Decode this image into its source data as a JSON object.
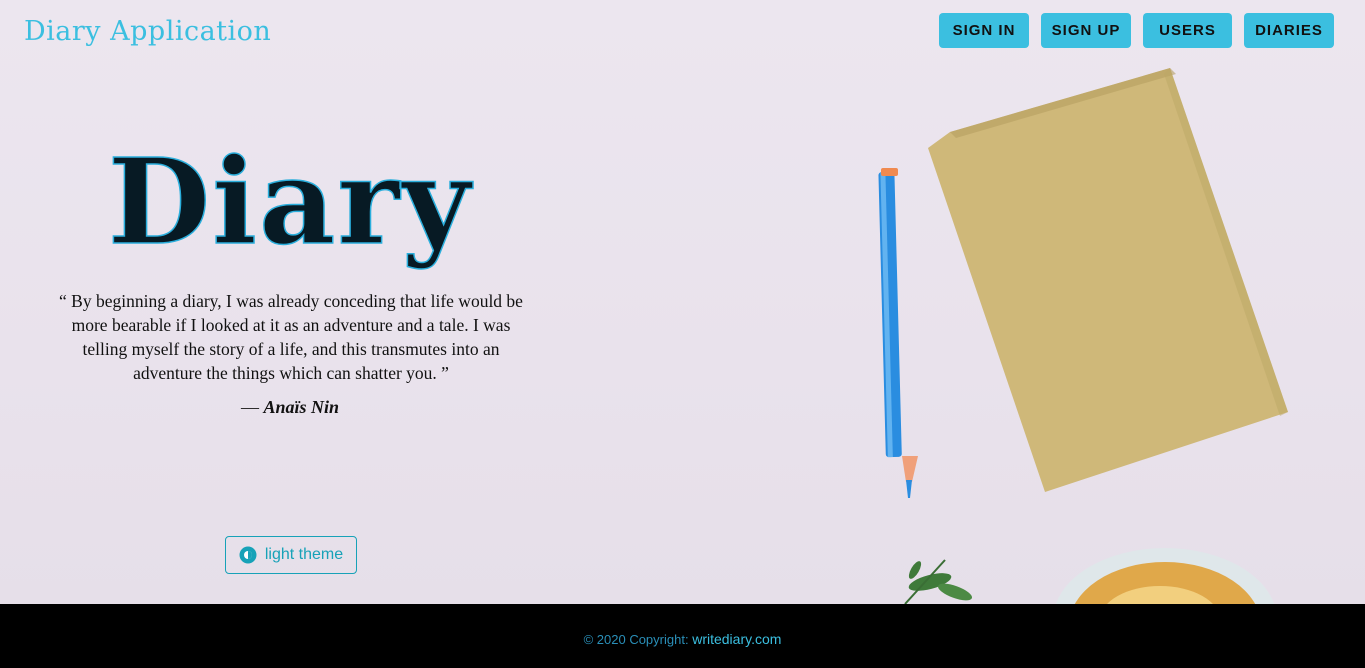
{
  "header": {
    "brand": "Diary Application",
    "nav": [
      {
        "label": "SIGN IN"
      },
      {
        "label": "SIGN UP"
      },
      {
        "label": "USERS"
      },
      {
        "label": "DIARIES"
      }
    ]
  },
  "hero": {
    "title": "Diary",
    "quote": "“ By beginning a diary, I was already conceding that life would be more bearable if I looked at it as an adventure and a tale. I was telling myself the story of a life, and this transmutes into an adventure the things which can shatter you. ”",
    "author_dash": "—",
    "author": "Anaïs Nin",
    "theme_button": {
      "label": "light theme",
      "icon": "theme-toggle-icon"
    }
  },
  "footer": {
    "copyright": "© 2020 Copyright:",
    "link": "writediary.com"
  },
  "colors": {
    "accent": "#3bbfe0",
    "button_text": "#111111",
    "outline_button": "#17a2b8",
    "footer_bg": "#000000",
    "notebook": "#d2b978",
    "pencil": "#2a8de0"
  }
}
